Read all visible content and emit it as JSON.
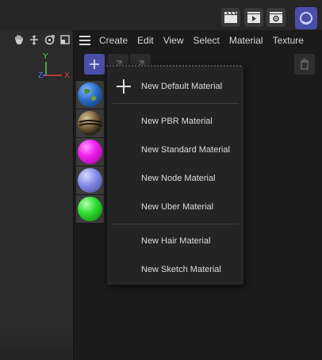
{
  "toolbar": {
    "buttons": [
      {
        "icon": "clapperboard-icon"
      },
      {
        "icon": "render-view-icon"
      },
      {
        "icon": "render-settings-icon"
      },
      {
        "icon": "redshift-icon"
      }
    ]
  },
  "viewport": {
    "nav_icons": [
      "hand-pan-icon",
      "move-icon",
      "rotate-icon",
      "maximize-icon"
    ],
    "axes": {
      "y": "Y",
      "z": "Z",
      "x": "X"
    },
    "colors": {
      "x": "#e04040",
      "y": "#4fd04f",
      "z": "#5a7bff"
    }
  },
  "material_manager": {
    "menu": [
      "Create",
      "Edit",
      "View",
      "Select",
      "Material",
      "Texture"
    ],
    "materials": [
      {
        "icon": "earth-material-icon",
        "color": "#2a6cc4"
      },
      {
        "icon": "metal-material-icon",
        "color": "#8a6d45"
      },
      {
        "icon": "magenta-material-icon",
        "color": "#f020f0"
      },
      {
        "icon": "lavender-material-icon",
        "color": "#8a90e8"
      },
      {
        "icon": "green-material-icon",
        "color": "#30e030"
      }
    ]
  },
  "context_menu": {
    "items": [
      {
        "label": "New Default Material",
        "icon": "plus-icon"
      },
      {
        "label": "New PBR Material"
      },
      {
        "label": "New Standard Material"
      },
      {
        "label": "New Node Material"
      },
      {
        "label": "New Uber Material"
      },
      {
        "label": "New Hair Material"
      },
      {
        "label": "New Sketch Material"
      }
    ]
  },
  "colors": {
    "accent": "#4a4fa8"
  }
}
